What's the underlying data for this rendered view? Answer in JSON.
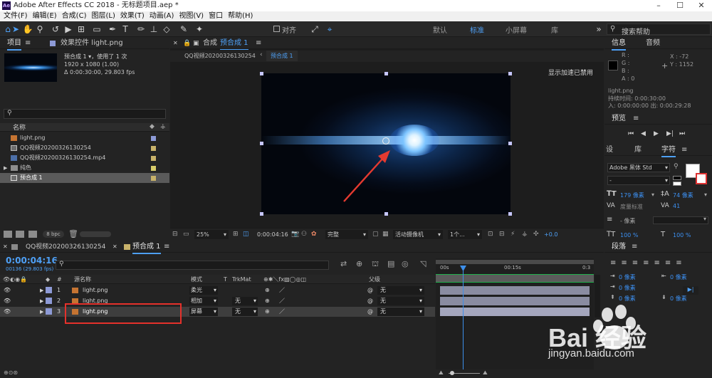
{
  "app": {
    "title": "Adobe After Effects CC 2018 - 无标题项目.aep *",
    "logo": "Ae"
  },
  "menu": [
    "文件(F)",
    "编辑(E)",
    "合成(C)",
    "图层(L)",
    "效果(T)",
    "动画(A)",
    "视图(V)",
    "窗口",
    "帮助(H)"
  ],
  "toolbar": {
    "snap_label": "对齐",
    "workspaces": [
      "默认",
      "标准",
      "小屏幕",
      "库"
    ],
    "active_workspace": "标准",
    "search_placeholder": "搜索帮助"
  },
  "project": {
    "tab_project": "项目",
    "tab_effects": "效果控件 light.png",
    "comp_name": "预合成 1 ▾，使用了 1 次",
    "comp_size": "1920 x 1080 (1.00)",
    "comp_duration": "Δ 0:00:30:00, 29.803 fps",
    "col_name": "名称",
    "items": [
      {
        "name": "light.png",
        "color": "#8d9ad6"
      },
      {
        "name": "QQ视频20200326130254",
        "color": "#c8b26a"
      },
      {
        "name": "QQ视频20200326130254.mp4",
        "color": "#c8b26a"
      },
      {
        "name": "纯色",
        "color": "#d8cc6a"
      },
      {
        "name": "预合成 1",
        "color": "#c8b26a"
      }
    ],
    "bpc": "8 bpc"
  },
  "composition": {
    "tab_label": "合成",
    "tab_name": "预合成 1",
    "breadcrumb_parent": "QQ视频20200326130254",
    "breadcrumb_current": "预合成 1",
    "accel_notice": "显示加速已禁用",
    "zoom": "25%",
    "timecode": "0:00:04:16",
    "resolution": "完整",
    "camera": "活动摄像机",
    "views": "1个...",
    "exposure": "+0.0"
  },
  "info": {
    "tab_info": "信息",
    "tab_audio": "音频",
    "r": "R :",
    "g": "G :",
    "b": "B :",
    "a": "A : 0",
    "x": "X : -72",
    "y": "Y : 1152",
    "layer": "light.png",
    "duration": "持续时间: 0:00:30:00",
    "inout": "入: 0:00:00:00  出: 0:00:29:28"
  },
  "preview": {
    "title": "预览"
  },
  "character": {
    "tabs": [
      "设",
      "库",
      "字符"
    ],
    "font": "Adobe 黑体 Std",
    "style": "-",
    "size": "179 像素",
    "leading": "74 像素",
    "kerning": "度量标准",
    "tracking": "41",
    "stroke": "- 像素",
    "vscale": "100 %",
    "hscale": "100 %"
  },
  "paragraph": {
    "title": "段落",
    "v1": "0 像素",
    "v2": "0 像素",
    "v3": "0 像素",
    "v4": "0 像素",
    "v5": "0 像素"
  },
  "timeline": {
    "tab_parent": "QQ视频20200326130254",
    "tab_current": "预合成 1",
    "timecode": "0:00:04:16",
    "frames": "00136 (29.803 fps)",
    "cols": {
      "name": "源名称",
      "mode": "模式",
      "t": "T",
      "trkmat": "TrkMat",
      "parent": "父级"
    },
    "ruler": [
      "00s",
      "00:15s",
      "0:3"
    ],
    "layers": [
      {
        "num": "1",
        "name": "light.png",
        "mode": "柔光",
        "trkmat": "",
        "parent": "无",
        "label": "#8d9ad6"
      },
      {
        "num": "2",
        "name": "light.png",
        "mode": "相加",
        "trkmat": "无",
        "parent": "无",
        "label": "#8d9ad6"
      },
      {
        "num": "3",
        "name": "light.png",
        "mode": "屏幕",
        "trkmat": "无",
        "parent": "无",
        "label": "#8d9ad6"
      }
    ]
  },
  "watermark": {
    "brand": "Bai 经验",
    "url": "jingyan.baidu.com"
  }
}
